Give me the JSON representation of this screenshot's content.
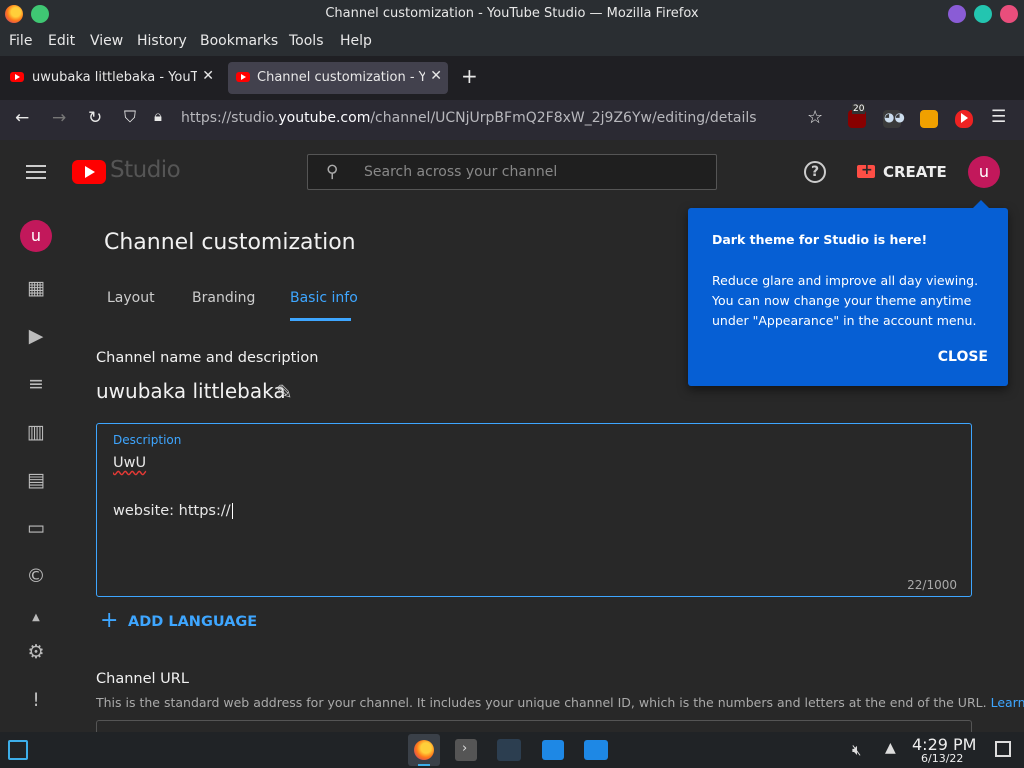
{
  "window": {
    "title": "Channel customization - YouTube Studio — Mozilla Firefox"
  },
  "menubar": {
    "items": [
      "File",
      "Edit",
      "View",
      "History",
      "Bookmarks",
      "Tools",
      "Help"
    ]
  },
  "tabs": [
    {
      "label": "uwubaka littlebaka - YouTu",
      "active": false
    },
    {
      "label": "Channel customization - Yo",
      "active": true
    }
  ],
  "navbar": {
    "url_prefix": "https://studio.",
    "url_domain": "youtube.com",
    "url_path": "/channel/UCNjUrpBFmQ2F8xW_2j9Z6Yw/editing/details",
    "ublock_count": "20"
  },
  "studio": {
    "logo_text": "Studio",
    "search_placeholder": "Search across your channel",
    "create_label": "CREATE",
    "avatar_letter": "u"
  },
  "sidebar": {
    "avatar_letter": "u",
    "items": [
      "dashboard-icon",
      "content-icon",
      "playlists-icon",
      "analytics-icon",
      "comments-icon",
      "subtitles-icon",
      "copyright-icon",
      "earn-icon",
      "settings-icon",
      "feedback-icon"
    ]
  },
  "page": {
    "title": "Channel customization",
    "tabs": [
      "Layout",
      "Branding",
      "Basic info"
    ],
    "active_tab": "Basic info",
    "section_name_heading": "Channel name and description",
    "channel_name": "uwubaka littlebaka",
    "description": {
      "label": "Description",
      "line1": "UwU",
      "line2": "website: https://",
      "count": "22/1000"
    },
    "add_language": "ADD LANGUAGE",
    "channel_url_heading": "Channel URL",
    "channel_url_desc": "This is the standard web address for your channel. It includes your unique channel ID, which is the numbers and letters at the end of the URL.",
    "learn_more": "Learn more"
  },
  "popup": {
    "title": "Dark theme for Studio is here!",
    "body": "Reduce glare and improve all day viewing. You can now change your theme anytime under \"Appearance\" in the account menu.",
    "close_label": "CLOSE"
  },
  "taskbar": {
    "time": "4:29 PM",
    "date": "6/13/22"
  }
}
